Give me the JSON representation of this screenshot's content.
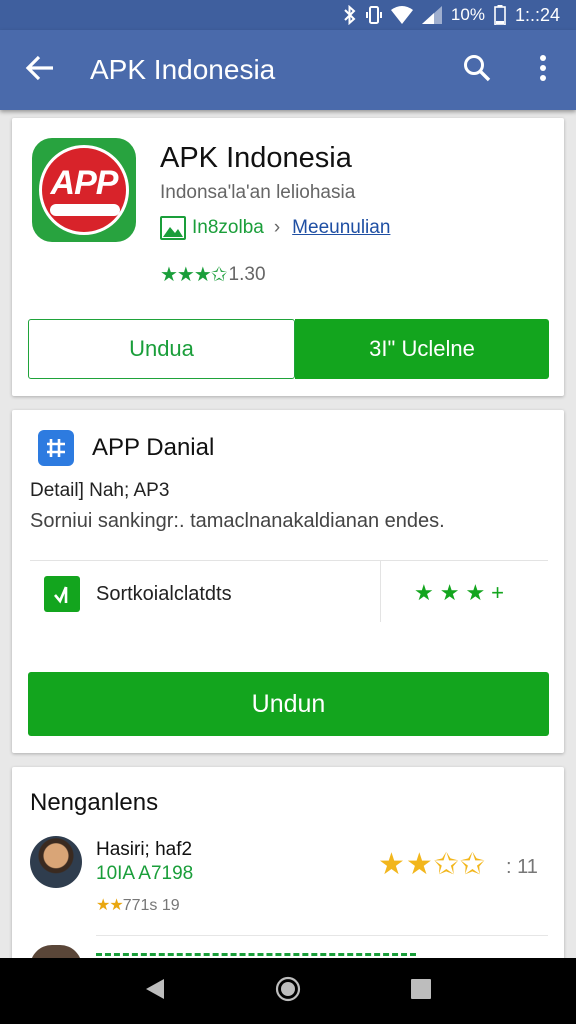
{
  "status_bar": {
    "battery_percent": "10%",
    "time": "1:.:24",
    "icons": [
      "bluetooth-icon",
      "vibrate-icon",
      "wifi-icon",
      "signal-icon",
      "battery-icon"
    ]
  },
  "app_bar": {
    "title": "APK Indonesia",
    "icons": [
      "back-arrow-icon",
      "search-icon",
      "more-vert-icon"
    ]
  },
  "app_card": {
    "name": "APK Indonesia",
    "subtitle": "Indonsa'la'an leliohasia",
    "icon_text": "APP",
    "developer": "In8zolba",
    "developer_link": "Meeunulian",
    "stars": "★★★✩",
    "rating": "1.30",
    "button_outline": "Undua",
    "button_fill": "3I\" Uclelne"
  },
  "details_card": {
    "title": "APP Danial",
    "detail": "Detail] Nah; AP3",
    "description": "Sorniui sankingr:. tamaclnanakaldianan endes.",
    "feature_label": "Sortkoialclatdts",
    "feature_stars": "★★★+",
    "download_button": "Undun"
  },
  "reviews_card": {
    "title": "Nenganlens",
    "reviews": [
      {
        "name": "Hasiri; haf2",
        "code": "10IA A7198",
        "small_stars": "★★",
        "small_text": "771s 19",
        "stars": "★★✩✩",
        "count": ": 11"
      }
    ]
  },
  "nav_bar": {
    "icons": [
      "back-nav-icon",
      "home-nav-icon",
      "recents-nav-icon"
    ]
  },
  "colors": {
    "status_bar": "#3f5f9e",
    "app_bar": "#4a6aab",
    "accent_green": "#13a51e",
    "star_gold": "#f2b61c"
  }
}
